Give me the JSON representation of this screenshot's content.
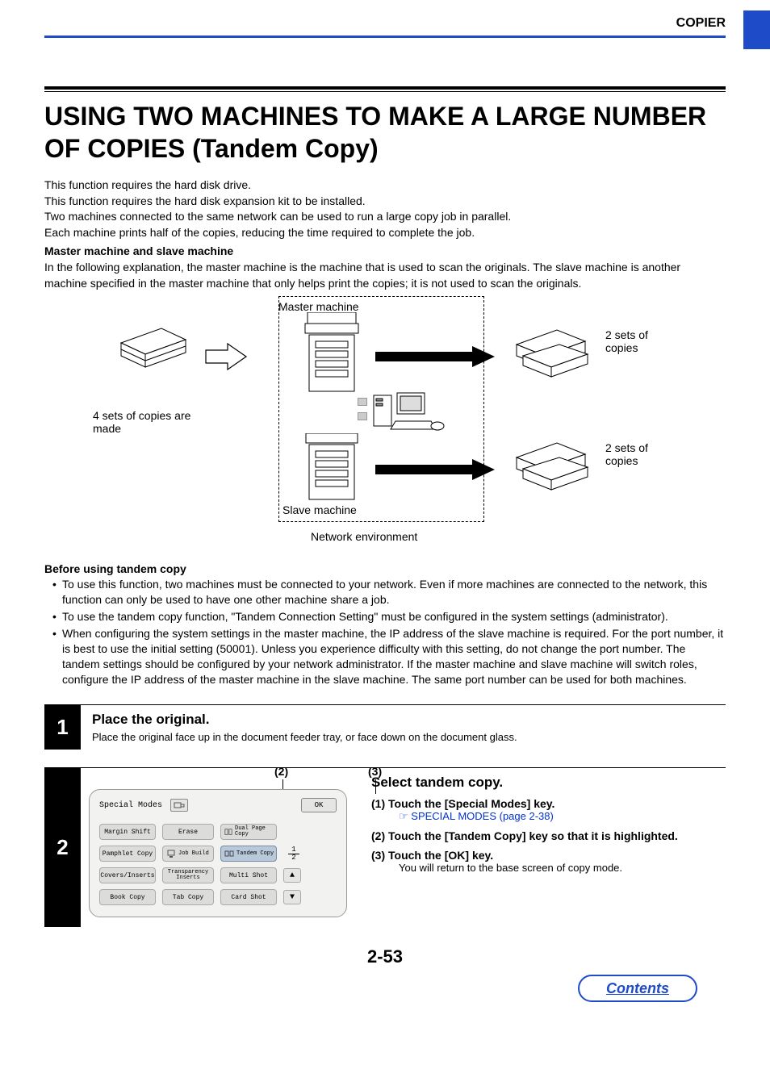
{
  "header": {
    "section": "COPIER"
  },
  "title": "USING TWO MACHINES TO MAKE A LARGE NUMBER OF COPIES (Tandem Copy)",
  "intro": {
    "p1": "This function requires the hard disk drive.",
    "p2": "This function requires the hard disk expansion kit to be installed.",
    "p3": "Two machines connected to the same network can be used to run a large copy job in parallel.",
    "p4": "Each machine prints half of the copies, reducing the time required to complete the job.",
    "subhead": "Master machine and slave machine",
    "p5": "In the following explanation, the master machine is the machine that is used to scan the originals. The slave machine is another machine specified in the master machine that only helps print the copies; it is not used to scan the originals."
  },
  "diagram": {
    "label_4sets": "4 sets of copies are made",
    "label_master": "Master machine",
    "label_slave": "Slave machine",
    "label_network": "Network environment",
    "label_2sets": "2 sets of copies"
  },
  "before": {
    "title": "Before using tandem copy",
    "b1": "To use this function, two machines must be connected to your network. Even if more machines are connected to the network, this function can only be used to have one other machine share a job.",
    "b2": "To use the tandem copy function, \"Tandem Connection Setting\" must be configured in the system settings (administrator).",
    "b3": "When configuring the system settings in the master machine, the IP address of the slave machine is required. For the port number, it is best to use the initial setting (50001). Unless you experience difficulty with this setting, do not change the port number. The tandem settings should be configured by your network administrator. If the master machine and slave machine will switch roles, configure the IP address of the master machine in the slave machine. The same port number can be used for both machines."
  },
  "step1": {
    "num": "1",
    "title": "Place the original.",
    "text": "Place the original face up in the document feeder tray, or face down on the document glass."
  },
  "step2": {
    "num": "2",
    "callouts": {
      "c2": "(2)",
      "c3": "(3)"
    },
    "panel": {
      "title": "Special Modes",
      "ok": "OK",
      "buttons": {
        "margin_shift": "Margin Shift",
        "erase": "Erase",
        "dual_page": "Dual Page Copy",
        "pamphlet": "Pamphlet Copy",
        "job_build": "Job Build",
        "tandem": "Tandem Copy",
        "covers": "Covers/Inserts",
        "transparency": "Transparency Inserts",
        "multi_shot": "Multi Shot",
        "book_copy": "Book Copy",
        "tab_copy": "Tab Copy",
        "card_shot": "Card Shot"
      },
      "page_indicator": {
        "current": "1",
        "total": "2"
      }
    },
    "instructions": {
      "heading": "Select tandem copy.",
      "i1_label": "(1)  Touch the [Special Modes] key.",
      "i1_link_text": "SPECIAL MODES",
      "i1_link_suffix": " (page 2-38)",
      "i2_label": "(2)  Touch the [Tandem Copy] key so that it is highlighted.",
      "i3_label": "(3)  Touch the [OK] key.",
      "i3_sub": "You will return to the base screen of copy mode."
    }
  },
  "page_number": "2-53",
  "contents_button": "Contents"
}
